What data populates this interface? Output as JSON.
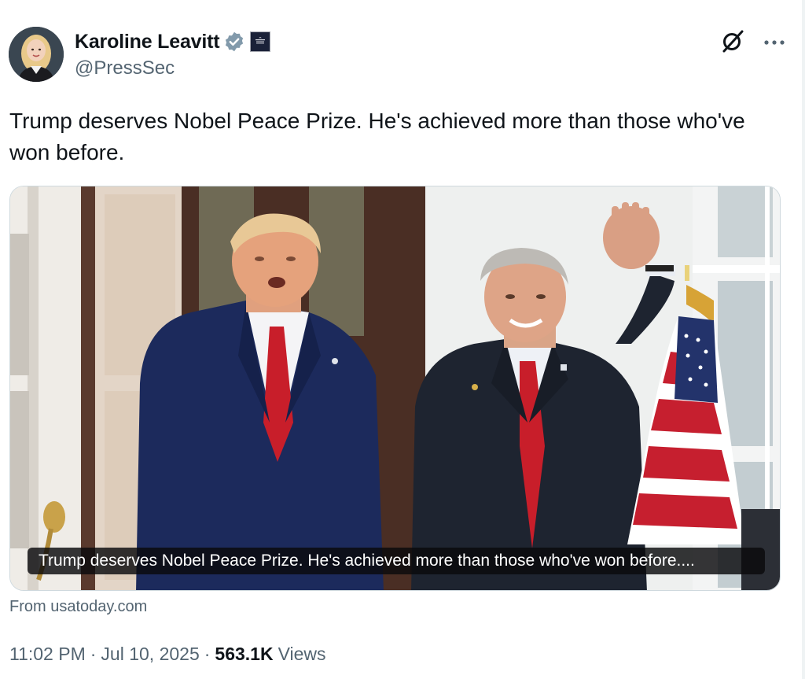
{
  "author": {
    "display_name": "Karoline Leavitt",
    "handle": "@PressSec",
    "verified_color": "#829aab",
    "affiliation_badge": "White House"
  },
  "tweet": {
    "text": "Trump deserves Nobel Peace Prize. He's achieved more than those who've won before."
  },
  "media": {
    "caption": "Trump deserves Nobel Peace Prize. He's achieved more than those who've won before....",
    "source": "From usatoday.com"
  },
  "meta": {
    "time": "11:02 PM",
    "date": "Jul 10, 2025",
    "views_count": "563.1K",
    "views_label": "Views",
    "separator": "·"
  },
  "icons": {
    "grok": "grok-icon",
    "more": "more-icon",
    "verified": "verified-badge-icon"
  }
}
